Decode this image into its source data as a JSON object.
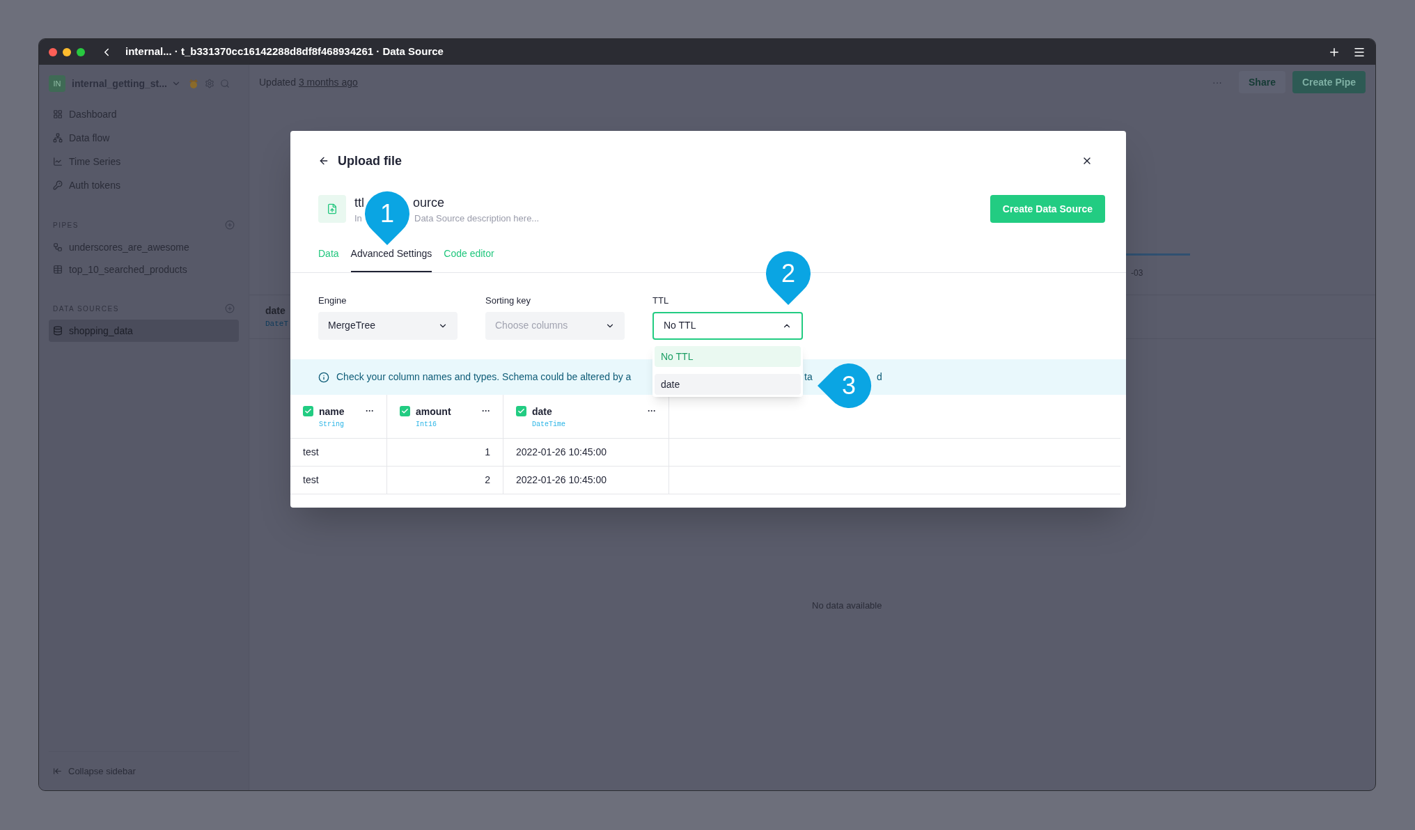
{
  "window": {
    "title": "internal... · t_b331370cc16142288d8df8f468934261 · Data Source"
  },
  "sidebar": {
    "workspace": {
      "avatar": "IN",
      "name": "internal_getting_st..."
    },
    "nav": [
      {
        "label": "Dashboard"
      },
      {
        "label": "Data flow"
      },
      {
        "label": "Time Series"
      },
      {
        "label": "Auth tokens"
      }
    ],
    "sections": [
      {
        "title": "PIPES",
        "items": [
          {
            "label": "underscores_are_awesome",
            "selected": false
          },
          {
            "label": "top_10_searched_products",
            "selected": false
          }
        ]
      },
      {
        "title": "DATA SOURCES",
        "items": [
          {
            "label": "shopping_data",
            "selected": true
          }
        ]
      }
    ],
    "collapse": "Collapse sidebar"
  },
  "header": {
    "updated": "Updated",
    "updated_link": "3 months ago",
    "more": "···",
    "share": "Share",
    "create_pipe": "Create Pipe"
  },
  "background": {
    "column_name": "date",
    "column_type": "DateT",
    "chart_tick": "-03",
    "empty": "No data available"
  },
  "modal": {
    "title": "Upload file",
    "name_parts": [
      "ttl",
      "ource"
    ],
    "description_parts": [
      "In",
      "Data Source description here..."
    ],
    "create_button": "Create Data Source",
    "tabs": [
      {
        "label": "Data",
        "selected": false
      },
      {
        "label": "Advanced Settings",
        "selected": true
      },
      {
        "label": "Code editor",
        "selected": false
      }
    ],
    "fields": [
      {
        "label": "Engine",
        "value": "MergeTree",
        "open": false
      },
      {
        "label": "Sorting key",
        "placeholder": "Choose columns",
        "open": false
      },
      {
        "label": "TTL",
        "value": "No TTL",
        "open": true
      }
    ],
    "dropdown": [
      {
        "label": "No TTL",
        "selected": true,
        "highlighted": false
      },
      {
        "label": "date",
        "selected": false,
        "highlighted": true
      }
    ],
    "banner_parts": [
      "Check your column names and types. Schema could be altered by a",
      "ta",
      "d"
    ],
    "columns": [
      {
        "name": "name",
        "type": "String",
        "checked": true,
        "menu": "···"
      },
      {
        "name": "amount",
        "type": "Int16",
        "checked": true,
        "menu": "···"
      },
      {
        "name": "date",
        "type": "DateTime",
        "checked": true,
        "menu": "···"
      }
    ],
    "rows": [
      [
        "test",
        "1",
        "2022-01-26 10:45:00"
      ],
      [
        "test",
        "2",
        "2022-01-26 10:45:00"
      ]
    ]
  },
  "callouts": [
    "1",
    "2",
    "3"
  ]
}
